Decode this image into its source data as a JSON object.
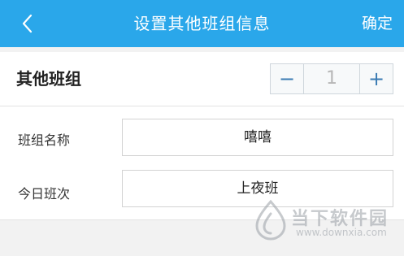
{
  "header": {
    "title": "设置其他班组信息",
    "confirm_label": "确定",
    "back_icon": "chevron-left-icon",
    "background": "#2aa7ea"
  },
  "group_row": {
    "label": "其他班组",
    "stepper": {
      "minus_label": "−",
      "value": "1",
      "plus_label": "+"
    }
  },
  "form": {
    "fields": [
      {
        "label": "班组名称",
        "value": "嘻嘻"
      },
      {
        "label": "今日班次",
        "value": "上夜班"
      }
    ]
  },
  "watermark": {
    "text": "当下软件园",
    "url": "www.downxia.com"
  }
}
